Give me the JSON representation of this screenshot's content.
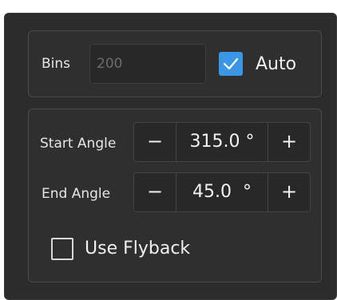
{
  "bins": {
    "label": "Bins",
    "value": "200",
    "auto_label": "Auto",
    "auto_checked": true
  },
  "start_angle": {
    "label": "Start Angle",
    "value": "315.0 °",
    "minus": "−",
    "plus": "+"
  },
  "end_angle": {
    "label": "End Angle",
    "value": "45.0  °",
    "minus": "−",
    "plus": "+"
  },
  "flyback": {
    "label": "Use Flyback",
    "checked": false
  },
  "colors": {
    "accent": "#3b97e6",
    "panel_bg": "#2c2c2c",
    "text": "#e6e6e6"
  }
}
